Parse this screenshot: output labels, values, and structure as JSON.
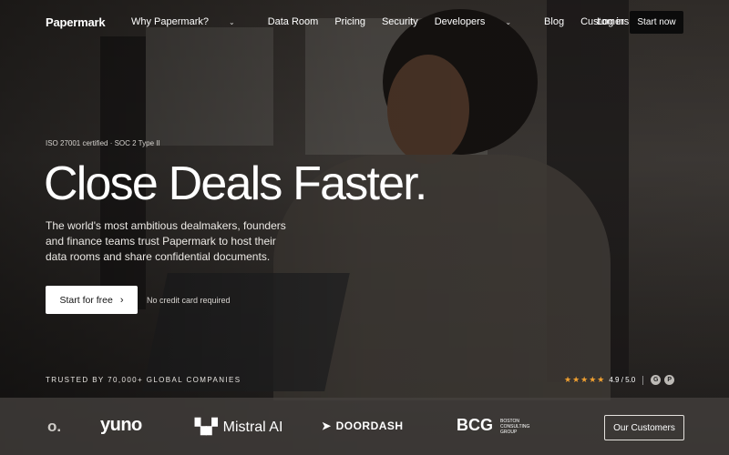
{
  "nav": {
    "logo": "Papermark",
    "items": [
      {
        "label": "Why Papermark?",
        "dropdown": true
      },
      {
        "label": "Data Room",
        "dropdown": false
      },
      {
        "label": "Pricing",
        "dropdown": false
      },
      {
        "label": "Security",
        "dropdown": false
      },
      {
        "label": "Developers",
        "dropdown": true
      },
      {
        "label": "Blog",
        "dropdown": false
      },
      {
        "label": "Customers",
        "dropdown": false
      }
    ],
    "login": "Log in",
    "start": "Start now"
  },
  "hero": {
    "certifications": "ISO 27001 certified · SOC 2 Type II",
    "headline": "Close Deals Faster.",
    "subheadline": "The world's most ambitious dealmakers, founders and finance teams trust Papermark to host their data rooms and share confidential documents.",
    "cta": "Start for free",
    "cta_note": "No credit card required"
  },
  "social_proof": {
    "trusted": "TRUSTED BY 70,000+ GLOBAL COMPANIES",
    "rating": "4.9 / 5.0",
    "stars": 5,
    "badges": [
      "G",
      "P"
    ],
    "logos": [
      "o.",
      "yuno",
      "Mistral AI",
      "DOORDASH",
      "BCG",
      "BOSTON CONSULTING GROUP"
    ],
    "customers_button": "Our Customers"
  },
  "colors": {
    "accent_star": "#f0a030",
    "cta_bg": "#ffffff",
    "nav_button_bg": "#0b0b0b"
  }
}
